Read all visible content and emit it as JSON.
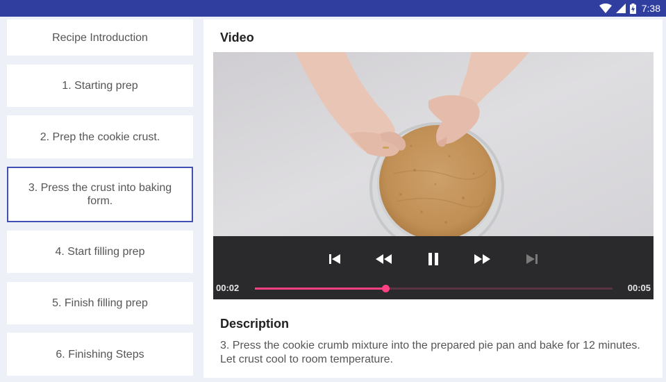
{
  "status_bar": {
    "time": "7:38"
  },
  "steps": [
    {
      "label": "Recipe Introduction",
      "selected": false
    },
    {
      "label": "1. Starting prep",
      "selected": false
    },
    {
      "label": "2. Prep the cookie crust.",
      "selected": false
    },
    {
      "label": "3. Press the crust into baking form.",
      "selected": true
    },
    {
      "label": "4. Start filling prep",
      "selected": false
    },
    {
      "label": "5. Finish filling prep",
      "selected": false
    },
    {
      "label": "6. Finishing Steps",
      "selected": false
    }
  ],
  "detail": {
    "video_heading": "Video",
    "description_heading": "Description",
    "description_text": "3. Press the cookie crumb mixture into the prepared pie pan and bake for 12 minutes. Let crust cool to room temperature."
  },
  "player": {
    "position": "00:02",
    "duration": "00:05",
    "progress": 0.365,
    "state": "playing",
    "next_enabled": false
  },
  "colors": {
    "accent": "#ff4081",
    "primary_dark": "#303f9f",
    "selected_border": "#3f51b5"
  }
}
